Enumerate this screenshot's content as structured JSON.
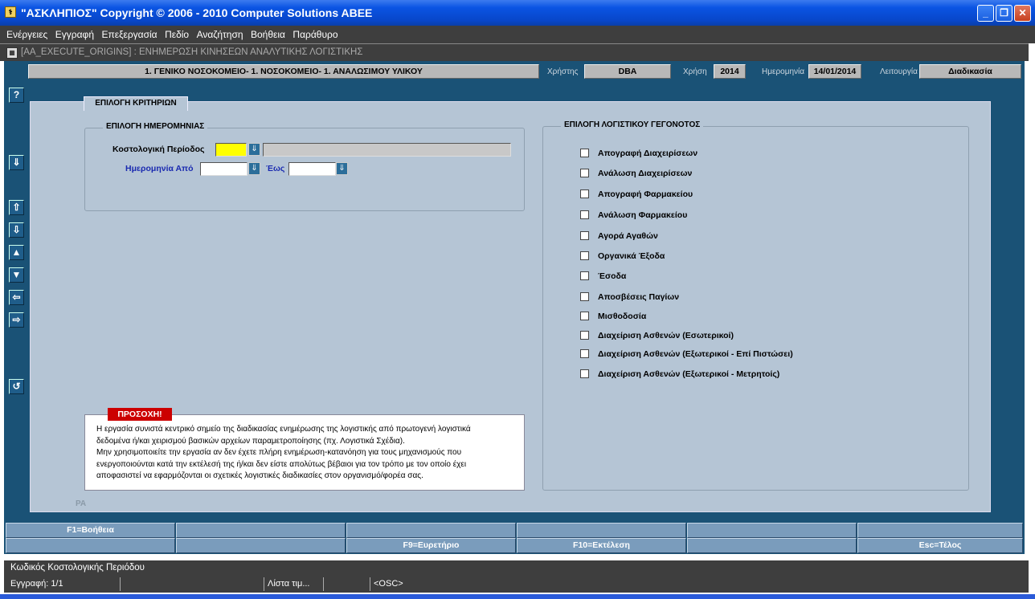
{
  "window": {
    "title": "\"ΑΣΚΛΗΠΙΟΣ\" Copyright © 2006 - 2010 Computer Solutions ABEE"
  },
  "menu": [
    "Ενέργειες",
    "Εγγραφή",
    "Επεξεργασία",
    "Πεδίο",
    "Αναζήτηση",
    "Βοήθεια",
    "Παράθυρο"
  ],
  "form": {
    "title": "[AA_EXECUTE_ORIGINS]  :  ΕΝΗΜΕΡΩΣΗ ΚΙΝΗΣΕΩΝ ΑΝΑΛΥΤΙΚΗΣ ΛΟΓΙΣΤΙΚΗΣ"
  },
  "info": {
    "org": "1. ΓΕΝΙΚΟ ΝΟΣΟΚΟΜΕΙΟ- 1. ΝΟΣΟΚΟΜΕΙΟ- 1. ΑΝΑΛΩΣΙΜΟΥ ΥΛΙΚΟΥ",
    "user_label": "Χρήστης",
    "user": "DBA",
    "year_label": "Χρήση",
    "year": "2014",
    "date_label": "Ημερομηνία",
    "date": "14/01/2014",
    "mode_label": "Λειτουργία",
    "mode": "Διαδικασία"
  },
  "tab": "ΕΠΙΛΟΓΗ ΚΡΙΤΗΡΙΩΝ",
  "date_group": {
    "title": "ΕΠΙΛΟΓΗ ΗΜΕΡΟΜΗΝΙΑΣ",
    "period_label": "Κοστολογική Περίοδος",
    "from_label": "Ημερομηνία Από",
    "to_label": "Έως"
  },
  "events_group": {
    "title": "ΕΠΙΛΟΓΗ ΛΟΓΙΣΤΙΚΟΥ ΓΕΓΟΝΟΤΟΣ",
    "items": [
      "Απογραφή Διαχειρίσεων",
      "Ανάλωση Διαχειρίσεων",
      "Απογραφή Φαρμακείου",
      "Ανάλωση Φαρμακείου",
      "Αγορά Αγαθών",
      "Οργανικά Έξοδα",
      "Έσοδα",
      "Αποσβέσεις Παγίων",
      "Μισθοδοσία",
      "Διαχείριση Ασθενών (Εσωτερικοί)",
      "Διαχείριση Ασθενών (Εξωτερικοί - Επί Πιστώσει)",
      "Διαχείριση Ασθενών (Εξωτερικοί - Μετρητοίς)"
    ]
  },
  "warning": {
    "header": "ΠΡΟΣΟΧΗ!",
    "lines": [
      "Η εργασία συνιστά κεντρικό σημείο της διαδικασίας ενημέρωσης της λογιστικής από πρωτογενή λογιστικά",
      "δεδομένα ή/και χειρισμού βασικών αρχείων παραμετροποίησης (πχ. Λογιστικά Σχέδια).",
      "Μην χρησιμοποιείτε την εργασία αν δεν έχετε πλήρη ενημέρωση-κατανόηση για τους μηχανισμούς που",
      "ενεργοποιούνται κατά την εκτέλεσή της ή/και δεν είστε απολύτως βέβαιοι για τον τρόπο με τον οποίο έχει",
      "αποφασιστεί να εφαρμόζονται οι σχετικές λογιστικές διαδικασίες στον οργανισμό/φορέα σας."
    ]
  },
  "pa": "PA",
  "fkeys_row1": [
    "F1=Βοήθεια",
    "",
    "",
    "",
    "",
    ""
  ],
  "fkeys_row2": [
    "",
    "",
    "F9=Ευρετήριο",
    "F10=Εκτέλεση",
    "",
    "Esc=Τέλος"
  ],
  "status": {
    "hint": "Κωδικός Κοστολογικής Περιόδου",
    "record": "Εγγραφή: 1/1",
    "list": "Λίστα τιμ...",
    "osc": "<OSC>"
  },
  "colors": {
    "accent": "#1a5276",
    "warning": "#cc0000",
    "field_highlight": "#ffff00"
  }
}
